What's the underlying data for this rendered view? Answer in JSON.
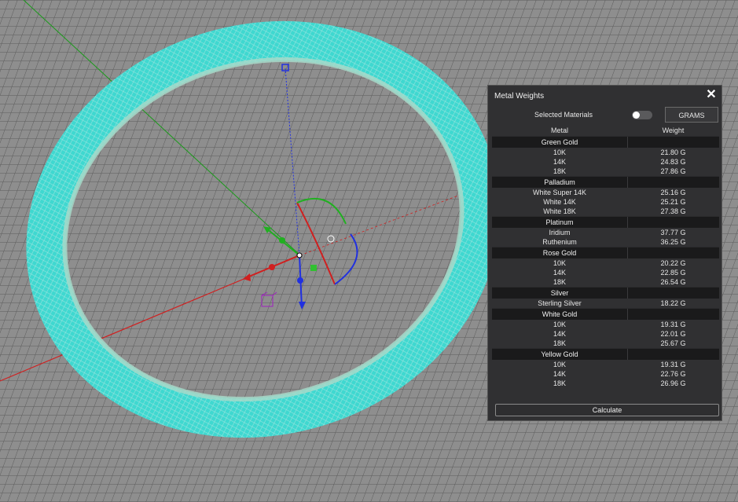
{
  "panel": {
    "title": "Metal Weights",
    "close_icon": "close-icon",
    "selected_materials_label": "Selected Materials",
    "selected_materials_on": false,
    "units_label": "GRAMS",
    "column_metal": "Metal",
    "column_weight": "Weight",
    "calculate_label": "Calculate"
  },
  "groups": [
    {
      "name": "Green Gold",
      "items": [
        {
          "name": "10K",
          "weight": "21.80 G"
        },
        {
          "name": "14K",
          "weight": "24.83 G"
        },
        {
          "name": "18K",
          "weight": "27.86 G"
        }
      ]
    },
    {
      "name": "Palladium",
      "items": [
        {
          "name": "White Super 14K",
          "weight": "25.16 G"
        },
        {
          "name": "White 14K",
          "weight": "25.21 G"
        },
        {
          "name": "White 18K",
          "weight": "27.38 G"
        }
      ]
    },
    {
      "name": "Platinum",
      "items": [
        {
          "name": "Iridium",
          "weight": "37.77 G"
        },
        {
          "name": "Ruthenium",
          "weight": "36.25 G"
        }
      ]
    },
    {
      "name": "Rose Gold",
      "items": [
        {
          "name": "10K",
          "weight": "20.22 G"
        },
        {
          "name": "14K",
          "weight": "22.85 G"
        },
        {
          "name": "18K",
          "weight": "26.54 G"
        }
      ]
    },
    {
      "name": "Silver",
      "items": [
        {
          "name": "Sterling Silver",
          "weight": "18.22 G"
        }
      ]
    },
    {
      "name": "White Gold",
      "items": [
        {
          "name": "10K",
          "weight": "19.31 G"
        },
        {
          "name": "14K",
          "weight": "22.01 G"
        },
        {
          "name": "18K",
          "weight": "25.67 G"
        }
      ]
    },
    {
      "name": "Yellow Gold",
      "items": [
        {
          "name": "10K",
          "weight": "19.31 G"
        },
        {
          "name": "14K",
          "weight": "22.76 G"
        },
        {
          "name": "18K",
          "weight": "26.96 G"
        }
      ]
    }
  ],
  "colors": {
    "mesh": "#3fd8d0",
    "viewport_bg": "#8e8e8e",
    "grid_line": "#5c5c5c",
    "axis_x": "#e02020",
    "axis_y": "#20b020",
    "axis_z": "#2030e0"
  }
}
